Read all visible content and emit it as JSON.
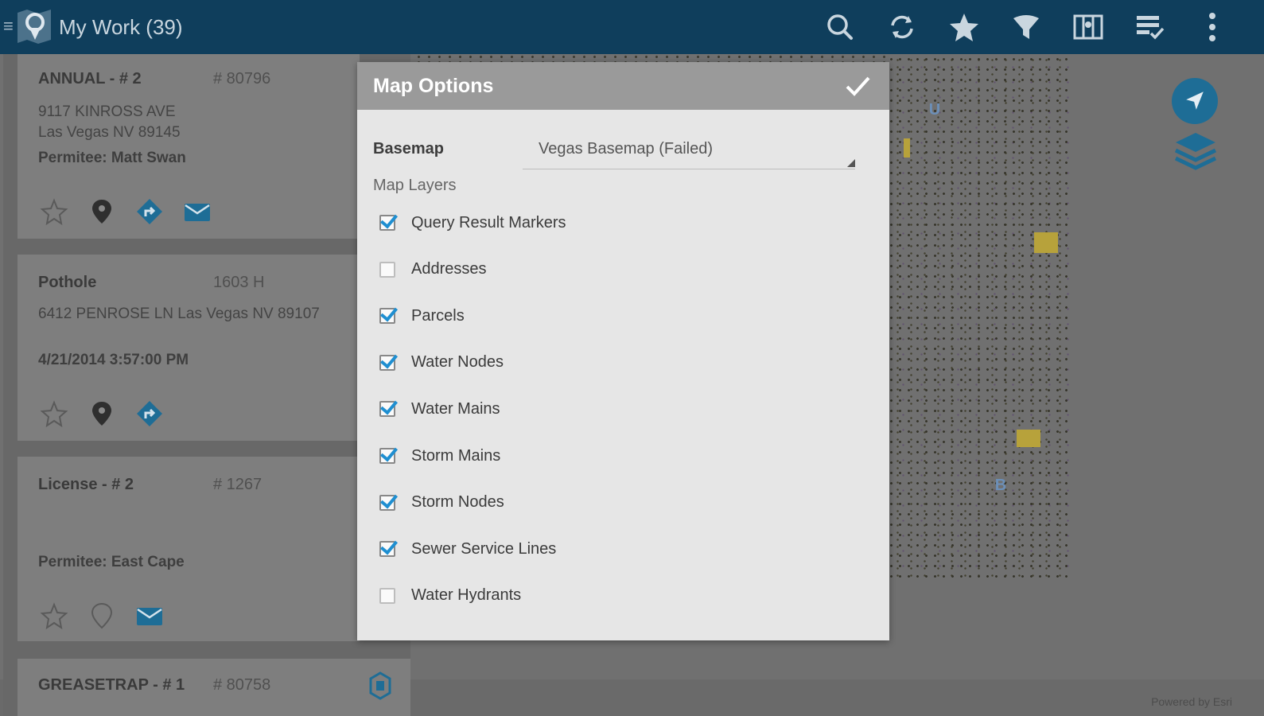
{
  "app": {
    "title": "My Work (39)"
  },
  "toolbar": {
    "icons": [
      "search-icon",
      "refresh-icon",
      "star-icon",
      "filter-icon",
      "map-view-icon",
      "task-list-icon",
      "more-icon"
    ]
  },
  "work_items": [
    {
      "title": "ANNUAL - # 2",
      "number": "# 80796",
      "line1": "9117 KINROSS AVE",
      "line2": "Las Vegas NV 89145",
      "line3": "Permitee: Matt Swan"
    },
    {
      "title": "Pothole",
      "number": "1603 H",
      "line1": "6412 PENROSE LN Las Vegas NV 89107",
      "line2": "",
      "line3": "4/21/2014 3:57:00 PM"
    },
    {
      "title": "License - # 2",
      "number": "# 1267",
      "line1": "",
      "line2": "",
      "line3": "Permitee:  East Cape"
    },
    {
      "title": "GREASETRAP - # 1",
      "number": "# 80758"
    }
  ],
  "dialog": {
    "title": "Map Options",
    "basemap_label": "Basemap",
    "basemap_value": "Vegas Basemap (Failed)",
    "layers_heading": "Map Layers",
    "layers": [
      {
        "label": "Query Result Markers",
        "checked": true
      },
      {
        "label": "Addresses",
        "checked": false
      },
      {
        "label": "Parcels",
        "checked": true
      },
      {
        "label": "Water Nodes",
        "checked": true
      },
      {
        "label": "Water Mains",
        "checked": true
      },
      {
        "label": "Storm Mains",
        "checked": true
      },
      {
        "label": "Storm Nodes",
        "checked": true
      },
      {
        "label": "Sewer Service Lines",
        "checked": true
      },
      {
        "label": "Water Hydrants",
        "checked": false
      }
    ]
  },
  "map": {
    "powered_by": "Powered by Esri",
    "marker_a": "U",
    "marker_b": "B"
  },
  "colors": {
    "header": "#0f3e5c",
    "accent": "#1f8fd1",
    "dialog_header": "#9a9a9a"
  }
}
